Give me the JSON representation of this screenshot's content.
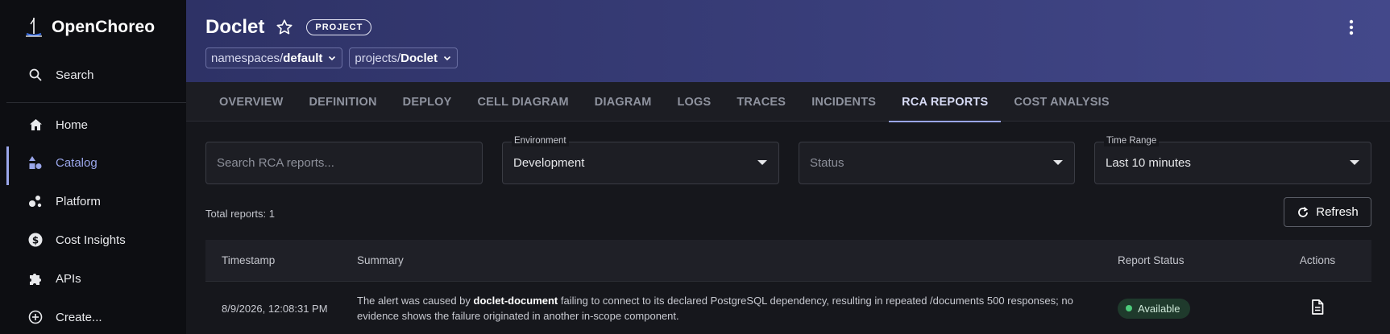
{
  "sidebar": {
    "brand": "OpenChoreo",
    "search_label": "Search",
    "items": [
      {
        "label": "Home",
        "icon": "home-icon"
      },
      {
        "label": "Catalog",
        "icon": "catalog-icon"
      },
      {
        "label": "Platform",
        "icon": "platform-icon"
      },
      {
        "label": "Cost Insights",
        "icon": "dollar-icon"
      },
      {
        "label": "APIs",
        "icon": "puzzle-icon"
      },
      {
        "label": "Create...",
        "icon": "plus-circle-icon"
      }
    ],
    "active_color": "#9aa6ea"
  },
  "header": {
    "title": "Doclet",
    "badge": "PROJECT",
    "crumbs": [
      {
        "prefix": "namespaces",
        "sep": "/",
        "value": "default"
      },
      {
        "prefix": "projects",
        "sep": "/",
        "value": "Doclet"
      }
    ]
  },
  "tabs": [
    "OVERVIEW",
    "DEFINITION",
    "DEPLOY",
    "CELL DIAGRAM",
    "DIAGRAM",
    "LOGS",
    "TRACES",
    "INCIDENTS",
    "RCA REPORTS",
    "COST ANALYSIS"
  ],
  "active_tab": "RCA REPORTS",
  "filters": {
    "search_placeholder": "Search RCA reports...",
    "environment_label": "Environment",
    "environment_value": "Development",
    "status_placeholder": "Status",
    "time_range_label": "Time Range",
    "time_range_value": "Last 10 minutes"
  },
  "total_reports": "Total reports: 1",
  "refresh_label": "Refresh",
  "table": {
    "headers": [
      "Timestamp",
      "Summary",
      "Report Status",
      "Actions"
    ],
    "rows": [
      {
        "timestamp": "8/9/2026, 12:08:31 PM",
        "summary_pre": "The alert was caused by ",
        "summary_bold": "doclet-document",
        "summary_post": " failing to connect to its declared PostgreSQL dependency, resulting in repeated /documents 500 responses; no evidence shows the failure originated in another in-scope component.",
        "status": "Available",
        "status_color": "#4ccb7a",
        "action_icon": "document-icon"
      }
    ]
  }
}
